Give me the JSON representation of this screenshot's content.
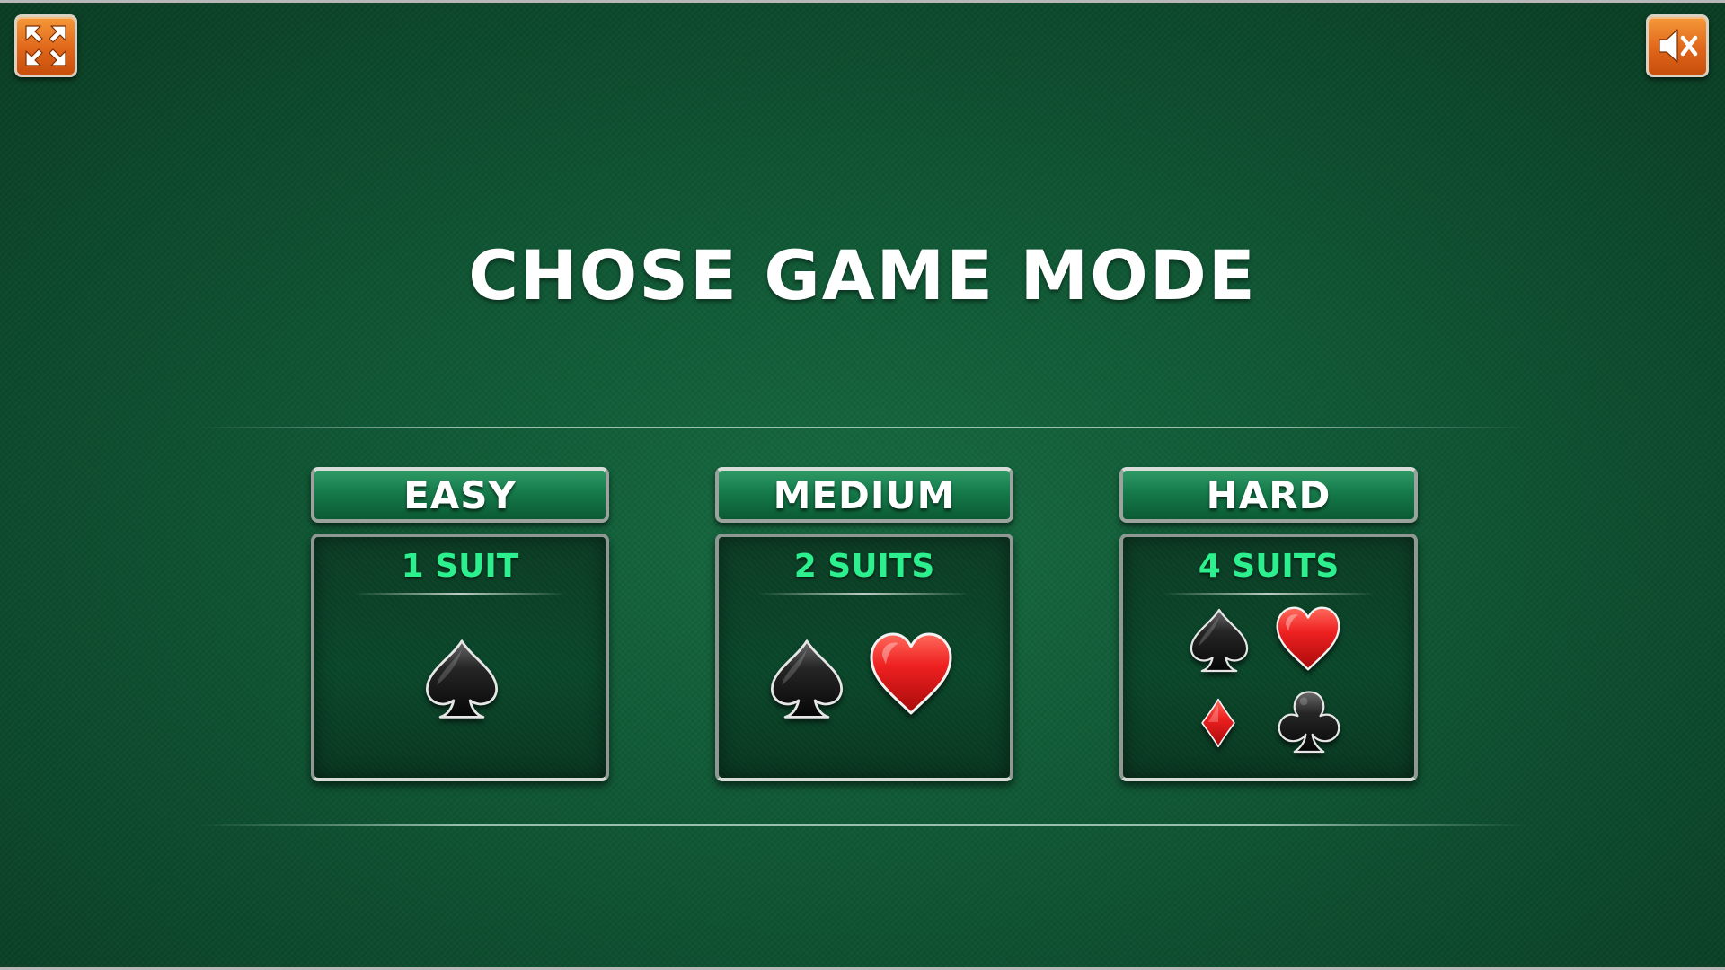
{
  "title": "CHOSE GAME MODE",
  "controls": {
    "fullscreen_icon": "fullscreen-expand-icon",
    "mute_icon": "speaker-muted-icon",
    "accent_color": "#e86d1e"
  },
  "modes": [
    {
      "label": "EASY",
      "suits_label": "1 SUIT",
      "suits": [
        "spade"
      ]
    },
    {
      "label": "MEDIUM",
      "suits_label": "2 SUITS",
      "suits": [
        "spade",
        "heart"
      ]
    },
    {
      "label": "HARD",
      "suits_label": "4 SUITS",
      "suits": [
        "spade",
        "heart",
        "diamond",
        "club"
      ]
    }
  ],
  "colors": {
    "background": "#0f5533",
    "suit_count_text": "#2cf08d",
    "title_text": "#ffffff",
    "red_suit": "#e01818",
    "black_suit": "#151515"
  }
}
